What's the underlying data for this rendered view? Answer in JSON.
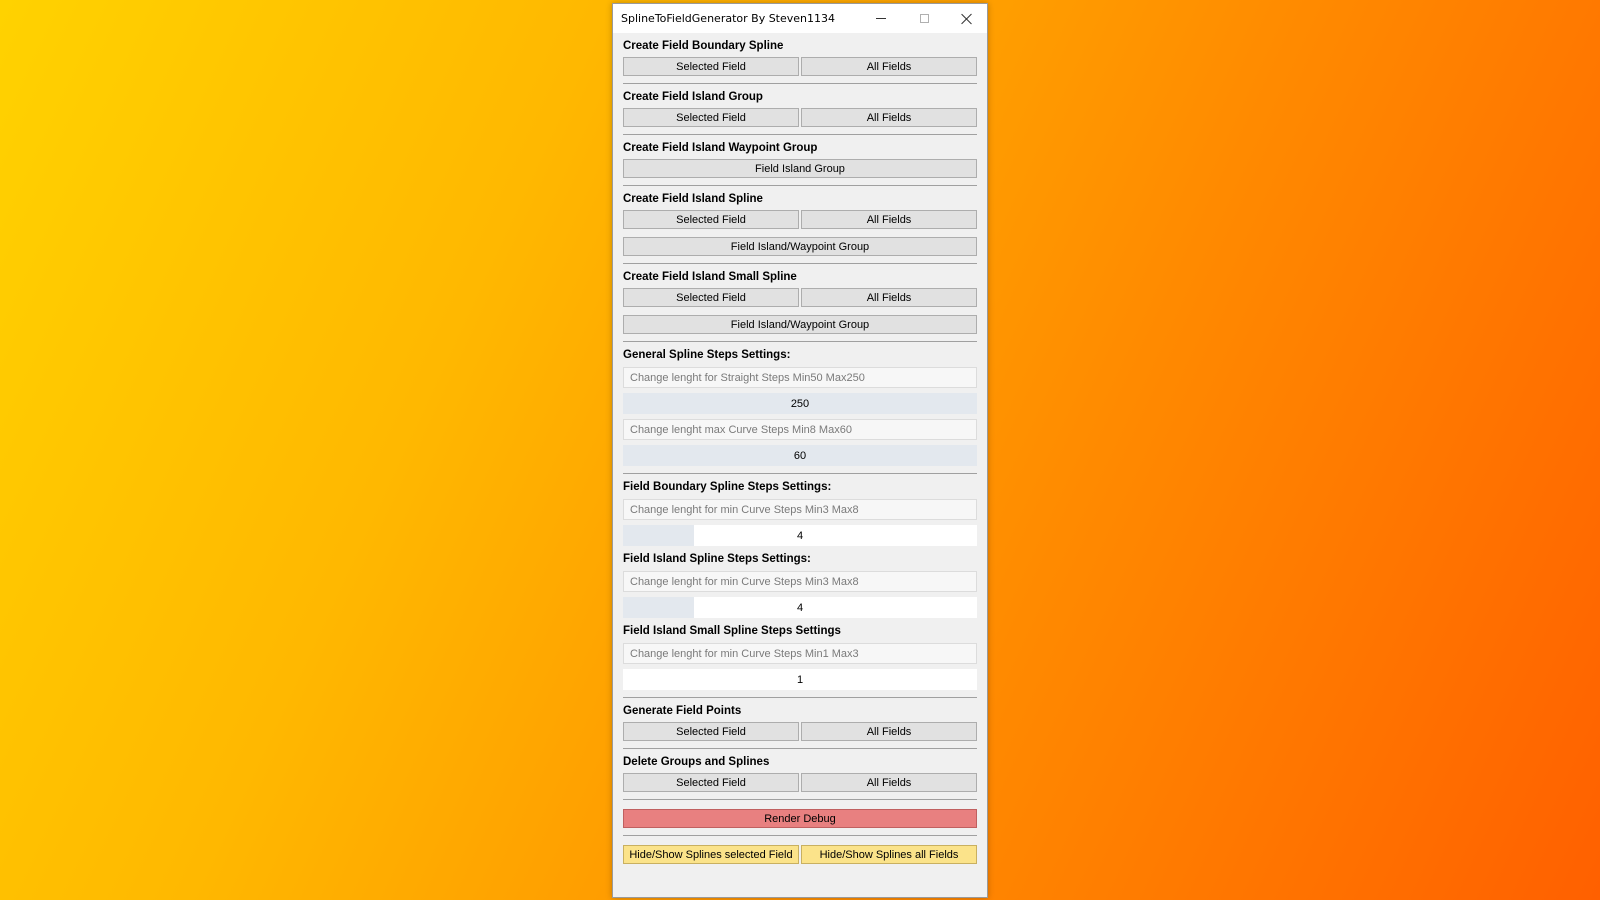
{
  "window": {
    "title": "SplineToFieldGenerator By Steven1134"
  },
  "sections": {
    "boundary": {
      "label": "Create Field Boundary Spline",
      "selected": "Selected Field",
      "all": "All Fields"
    },
    "island_group": {
      "label": "Create Field Island Group",
      "selected": "Selected Field",
      "all": "All Fields"
    },
    "waypoint_group": {
      "label": "Create Field Island Waypoint Group",
      "full": "Field Island Group"
    },
    "island_spline": {
      "label": "Create Field Island Spline",
      "selected": "Selected Field",
      "all": "All Fields",
      "full": "Field Island/Waypoint Group"
    },
    "island_small_spline": {
      "label": "Create Field Island Small Spline",
      "selected": "Selected Field",
      "all": "All Fields",
      "full": "Field Island/Waypoint Group"
    },
    "general_steps": {
      "label": "General Spline Steps Settings:",
      "straight_placeholder": "Change lenght for Straight Steps Min50 Max250",
      "straight_value": "250",
      "straight_fraction": 1.0,
      "curve_placeholder": "Change lenght max Curve Steps Min8 Max60",
      "curve_value": "60",
      "curve_fraction": 1.0
    },
    "boundary_steps": {
      "label": "Field Boundary Spline Steps Settings:",
      "placeholder": "Change lenght for min Curve Steps Min3 Max8",
      "value": "4",
      "fraction": 0.2
    },
    "island_steps": {
      "label": "Field Island Spline Steps Settings:",
      "placeholder": "Change lenght for min Curve Steps Min3 Max8",
      "value": "4",
      "fraction": 0.2
    },
    "island_small_steps": {
      "label": "Field Island Small Spline Steps Settings",
      "placeholder": "Change lenght for min Curve Steps Min1 Max3",
      "value": "1",
      "fraction": 0.0
    },
    "field_points": {
      "label": "Generate Field Points",
      "selected": "Selected Field",
      "all": "All Fields"
    },
    "delete": {
      "label": "Delete Groups and Splines",
      "selected": "Selected Field",
      "all": "All Fields"
    }
  },
  "render_debug": "Render Debug",
  "hide_show_selected": "Hide/Show Splines selected Field",
  "hide_show_all": "Hide/Show Splines all Fields",
  "colors": {
    "debug_button": "#e88080",
    "toggle_button": "#fbe38a",
    "background_start": "#ffd200",
    "background_end": "#ff6000"
  }
}
